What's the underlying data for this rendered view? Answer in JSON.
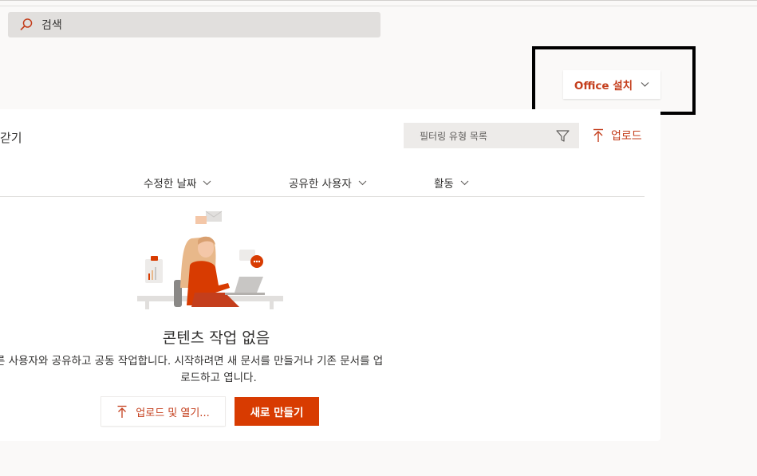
{
  "search": {
    "placeholder": "검색"
  },
  "header": {
    "office_button_label": "Office 설치"
  },
  "files": {
    "title_fragment": "갇기",
    "filter_placeholder": "필터링 유형 목록",
    "upload_label": "업로드",
    "columns": [
      "수정한 날짜",
      "공유한 사용자",
      "활동"
    ]
  },
  "empty_state": {
    "title": "콘텐츠 작업 없음",
    "description_line1": "른 사용자와 공유하고 공동 작업합니다. 시작하려면 새 문서를 만들거나 기존 문서를 업",
    "description_line2": "로드하고 엽니다.",
    "upload_open_label": "업로드 및 열기...",
    "new_label": "새로 만들기"
  },
  "colors": {
    "accent": "#c43e1c",
    "primary_button": "#d83b01"
  },
  "icons": [
    "search-icon",
    "chevron-down-icon",
    "filter-icon",
    "upload-arrow-icon"
  ]
}
